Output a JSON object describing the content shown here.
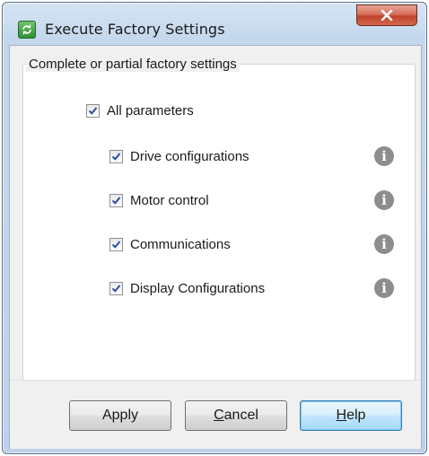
{
  "window": {
    "title": "Execute Factory Settings",
    "app_icon": "green-refresh-icon",
    "close_icon": "close-icon"
  },
  "group": {
    "legend": "Complete or partial factory settings"
  },
  "options": {
    "all": {
      "label": "All parameters",
      "checked": true
    },
    "items": [
      {
        "label": "Drive configurations",
        "checked": true,
        "info_icon": "info-icon"
      },
      {
        "label": "Motor control",
        "checked": true,
        "info_icon": "info-icon"
      },
      {
        "label": "Communications",
        "checked": true,
        "info_icon": "info-icon"
      },
      {
        "label": "Display Configurations",
        "checked": true,
        "info_icon": "info-icon"
      }
    ]
  },
  "buttons": {
    "apply": "Apply",
    "cancel_mnemonic": "C",
    "cancel_rest": "ancel",
    "help_mnemonic": "H",
    "help_rest": "elp"
  }
}
